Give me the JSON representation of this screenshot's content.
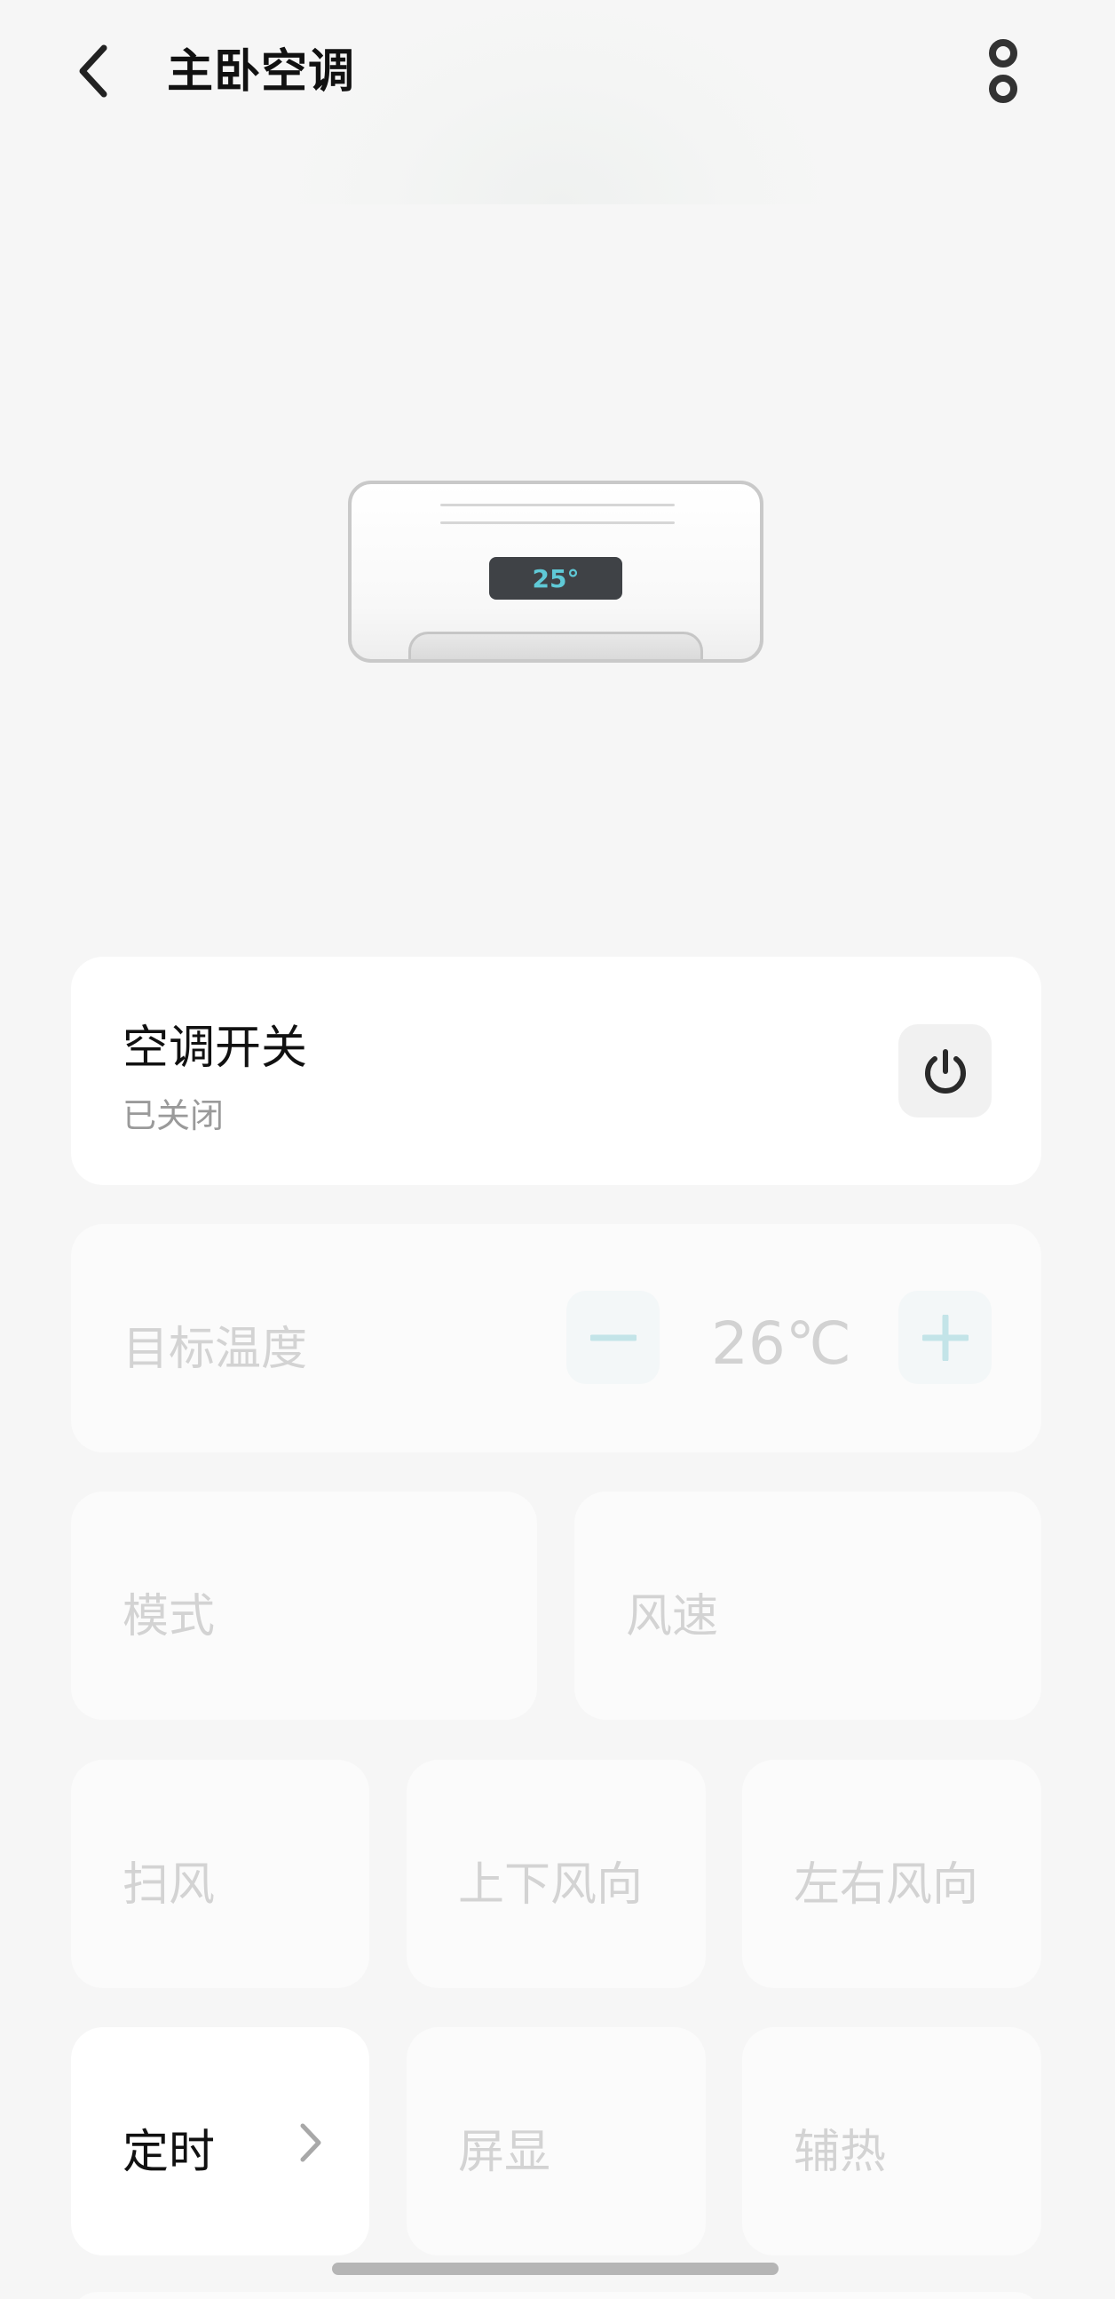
{
  "header": {
    "title": "主卧空调"
  },
  "ac_display": {
    "temp": "25°"
  },
  "power": {
    "label": "空调开关",
    "status": "已关闭"
  },
  "target_temp": {
    "label": "目标温度",
    "value": "26℃"
  },
  "mode": {
    "label": "模式"
  },
  "fan_speed": {
    "label": "风速"
  },
  "swing": {
    "label": "扫风"
  },
  "vertical_swing": {
    "label": "上下风向"
  },
  "horizontal_swing": {
    "label": "左右风向"
  },
  "timer": {
    "label": "定时"
  },
  "screen_display": {
    "label": "屏显"
  },
  "aux_heat": {
    "label": "辅热"
  },
  "colors": {
    "accent": "#5fc9d6",
    "text": "#111111",
    "disabled": "#d3d3d3",
    "background": "#f6f6f6"
  },
  "icons": [
    "back-arrow-icon",
    "more-options-icon",
    "power-icon",
    "minus-icon",
    "plus-icon",
    "chevron-right-icon"
  ]
}
